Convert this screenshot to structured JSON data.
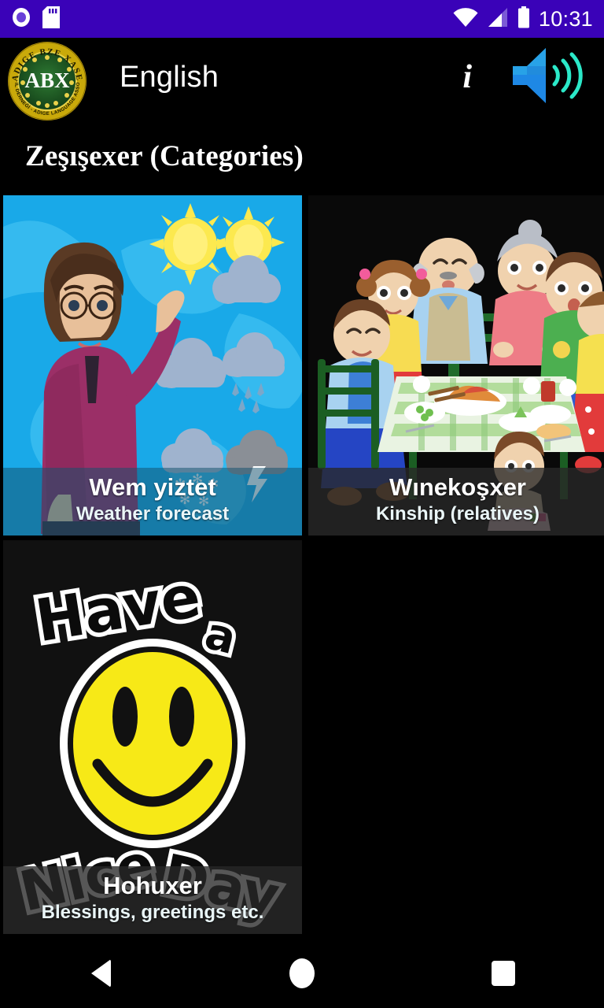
{
  "status_bar": {
    "background_color": "#3A02B8",
    "time": "10:31",
    "left_icons": [
      "recording-indicator-icon",
      "sd-card-icon"
    ],
    "right_icons": [
      "wifi-icon",
      "cellular-signal-icon",
      "battery-icon"
    ]
  },
  "app_bar": {
    "logo": {
      "name": "abx-logo",
      "top_arc_text": "ADIGE BZE XASE",
      "center_text": "ABX",
      "bottom_arc_text": "ADIGE DIL DERNEĞİ - ADIGE LANGUAGE ASSOCIATION",
      "ring_color": "#E3C60A",
      "field_color": "#1E5B24"
    },
    "title": "English",
    "info_icon_label": "i",
    "actions": [
      "info-icon",
      "sound-icon"
    ]
  },
  "page": {
    "heading": "Zeşışexer (Categories)",
    "background_color": "#000000"
  },
  "categories": [
    {
      "title": "Wem yiztet",
      "subtitle": "Weather forecast",
      "art": "weather-presenter-illustration",
      "caption_style": "light"
    },
    {
      "title": "Wınekoşxer",
      "subtitle": "Kinship (relatives)",
      "art": "clay-family-dinner-photo",
      "caption_style": "dark"
    },
    {
      "title": "Hohuxer",
      "subtitle": "Blessings, greetings etc.",
      "art": "have-a-nice-day-smiley",
      "caption_style": "dark"
    }
  ],
  "nav_bar": {
    "back_label": "Back",
    "home_label": "Home",
    "recents_label": "Recents"
  }
}
